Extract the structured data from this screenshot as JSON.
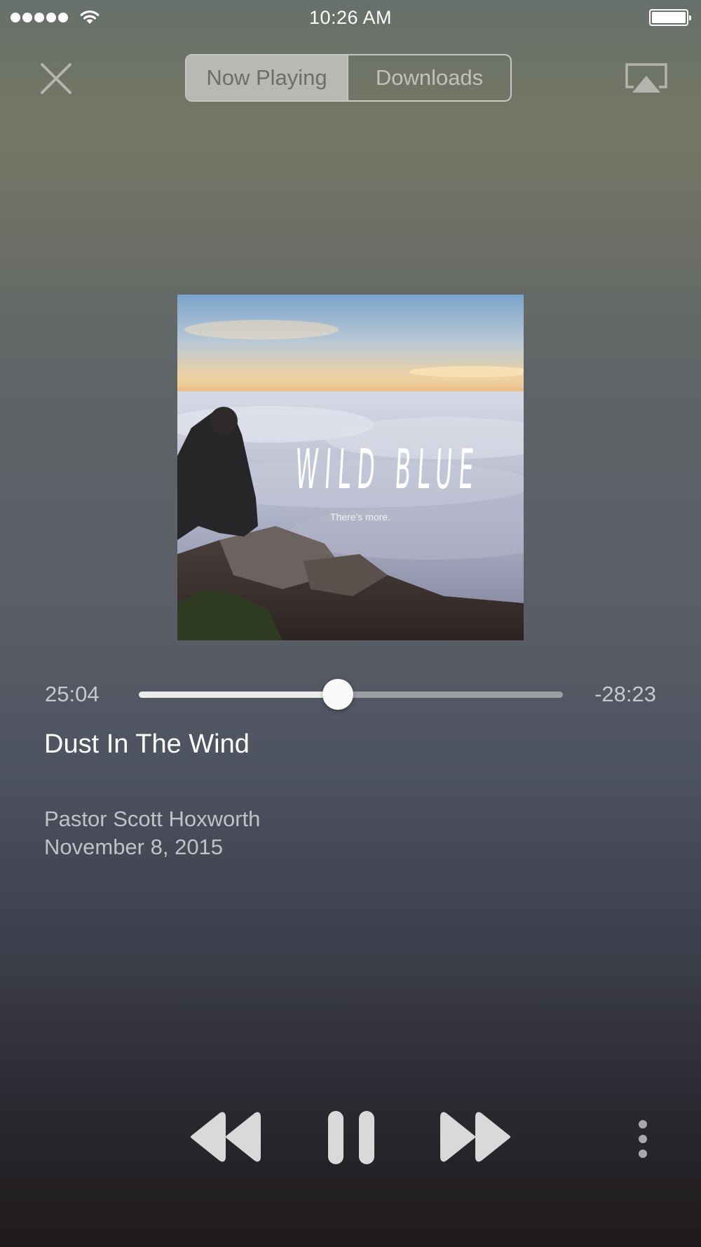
{
  "status_bar": {
    "time": "10:26 AM",
    "signal_icon": "signal-dots-icon",
    "wifi_icon": "wifi-icon",
    "battery_icon": "battery-icon"
  },
  "header": {
    "close_icon": "close-icon",
    "tabs": [
      {
        "label": "Now Playing",
        "active": true
      },
      {
        "label": "Downloads",
        "active": false
      }
    ],
    "airplay_icon": "airplay-icon"
  },
  "artwork": {
    "title": "WILD BLUE",
    "subtitle": "There's more."
  },
  "player": {
    "elapsed": "25:04",
    "remaining": "-28:23",
    "progress": 0.469,
    "track_title": "Dust In The Wind",
    "speaker": "Pastor Scott Hoxworth",
    "date": "November 8, 2015"
  },
  "controls": {
    "rewind_icon": "rewind-icon",
    "pause_icon": "pause-icon",
    "forward_icon": "fast-forward-icon",
    "more_icon": "more-vertical-icon"
  },
  "colors": {
    "accent_text": "#ffffff",
    "secondary_text": "#bfc2c7",
    "segment_active_bg": "#b8b9b5",
    "control_fill": "#d9d9d9"
  }
}
